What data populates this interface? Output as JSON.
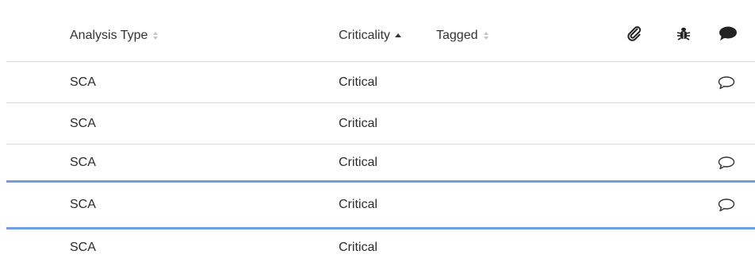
{
  "columns": {
    "analysis_type": "Analysis Type",
    "criticality": "Criticality",
    "tagged": "Tagged"
  },
  "header_icons": [
    "paperclip-icon",
    "bug-icon",
    "comment-filled-icon"
  ],
  "rows": [
    {
      "analysis_type": "SCA",
      "criticality": "Critical",
      "has_comment": true
    },
    {
      "analysis_type": "SCA",
      "criticality": "Critical",
      "has_comment": false
    },
    {
      "analysis_type": "SCA",
      "criticality": "Critical",
      "has_comment": true
    },
    {
      "analysis_type": "SCA",
      "criticality": "Critical",
      "has_comment": true,
      "selected": true
    },
    {
      "analysis_type": "SCA",
      "criticality": "Critical",
      "has_comment": false
    }
  ],
  "colors": {
    "selection": "#6f9ee8",
    "divider": "#d9d9d9",
    "text": "#2b2b2b"
  }
}
